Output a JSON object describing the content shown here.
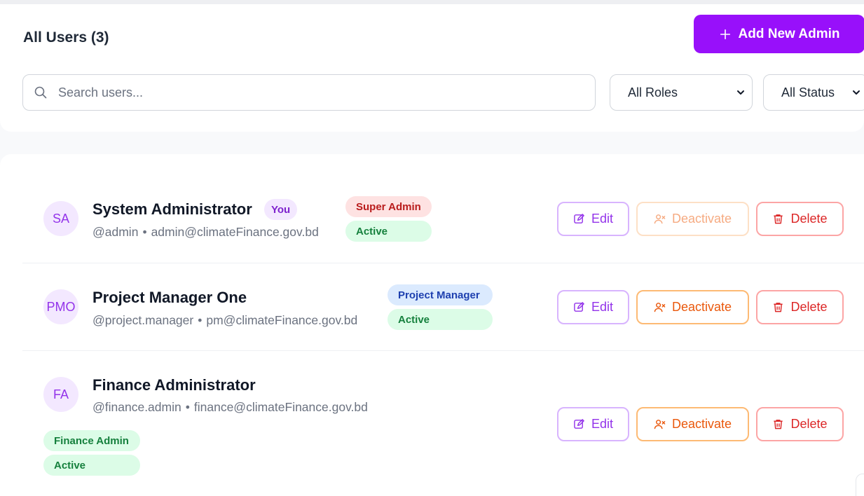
{
  "header": {
    "title": "All Users (3)",
    "add_button": "Add New Admin"
  },
  "filters": {
    "search_placeholder": "Search users...",
    "roles_selected": "All Roles",
    "status_selected": "All Status"
  },
  "icons": {
    "search": "search-icon",
    "plus": "plus-icon",
    "chevron": "chevron-down-icon",
    "edit": "edit-icon",
    "deactivate": "user-x-icon",
    "delete": "trash-icon"
  },
  "colors": {
    "brand": "#9810fa",
    "super_admin": "#b91c1c",
    "active": "#15803d",
    "project_manager": "#1e40af",
    "deactivate": "#ea580c",
    "delete": "#dc2626"
  },
  "users": [
    {
      "initials": "SA",
      "name": "System Administrator",
      "you_badge": "You",
      "username": "@admin",
      "email": "admin@climateFinance.gov.bd",
      "role": "Super Admin",
      "status": "Active",
      "deactivate_disabled": true
    },
    {
      "initials": "PMO",
      "name": "Project Manager One",
      "username": "@project.manager",
      "email": "pm@climateFinance.gov.bd",
      "role": "Project Manager",
      "status": "Active",
      "deactivate_disabled": false
    },
    {
      "initials": "FA",
      "name": "Finance Administrator",
      "username": "@finance.admin",
      "email": "finance@climateFinance.gov.bd",
      "role": "Finance Admin",
      "status": "Active",
      "deactivate_disabled": false
    }
  ],
  "actions": {
    "edit": "Edit",
    "deactivate": "Deactivate",
    "delete": "Delete",
    "separator": "•"
  }
}
